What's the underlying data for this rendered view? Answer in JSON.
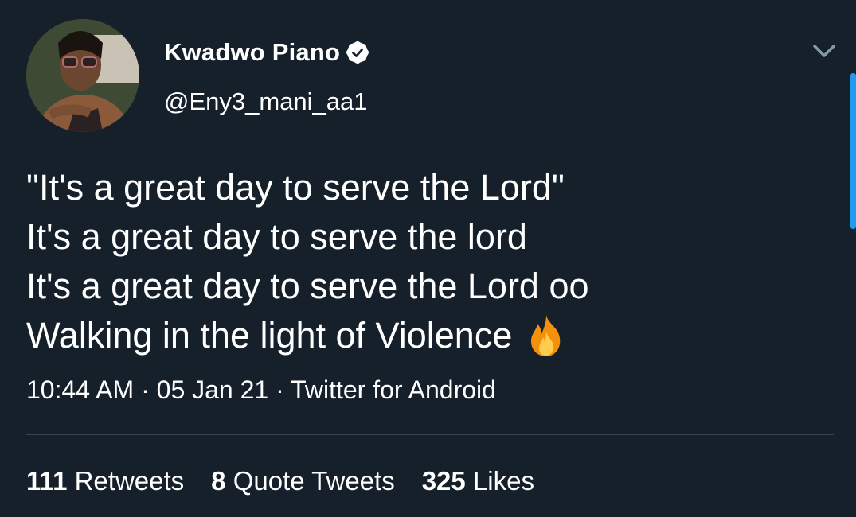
{
  "tweet": {
    "author": {
      "display_name": "Kwadwo Piano",
      "handle": "@Eny3_mani_aa1",
      "verified_icon": "verified-badge-icon",
      "avatar": "avatar"
    },
    "menu_icon": "chevron-down-icon",
    "lines": [
      "\"It's a great day to serve the Lord\"",
      "It's a great day to serve the lord",
      "It's a great day to serve the Lord oo",
      "Walking in the light of Violence"
    ],
    "emoji": "fire-icon",
    "meta": {
      "time": "10:44 AM",
      "separator": " · ",
      "date": "05 Jan 21",
      "source": "Twitter for Android"
    },
    "stats": {
      "retweets_count": "111",
      "retweets_label": "Retweets",
      "quotes_count": "8",
      "quotes_label": "Quote Tweets",
      "likes_count": "325",
      "likes_label": "Likes"
    }
  },
  "colors": {
    "background": "#15202b",
    "text": "#ffffff",
    "divider": "#38444d",
    "accent": "#1d9bf0",
    "muted_icon": "#8899a6"
  }
}
